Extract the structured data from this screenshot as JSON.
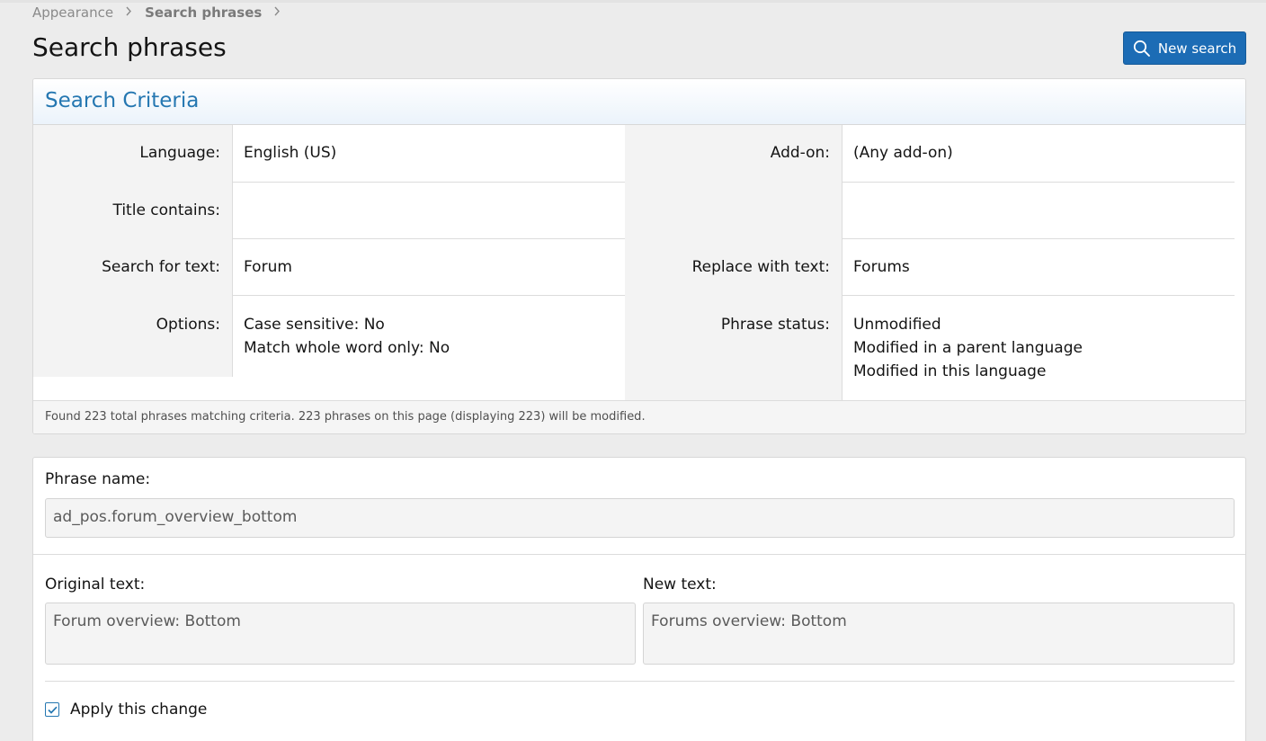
{
  "breadcrumb": [
    "Appearance",
    "Search phrases"
  ],
  "page_title": "Search phrases",
  "header": {
    "new_search_label": "New search"
  },
  "criteria": {
    "title": "Search Criteria",
    "left": {
      "language_label": "Language:",
      "language_value": "English (US)",
      "title_contains_label": "Title contains:",
      "title_contains_value": "",
      "search_text_label": "Search for text:",
      "search_text_value": "Forum",
      "options_label": "Options:",
      "options_values": [
        "Case sensitive: No",
        "Match whole word only: No"
      ]
    },
    "right": {
      "addon_label": "Add-on:",
      "addon_value": "(Any add-on)",
      "replace_label": "Replace with text:",
      "replace_value": "Forums",
      "status_label": "Phrase status:",
      "status_values": [
        "Unmodified",
        "Modified in a parent language",
        "Modified in this language"
      ]
    },
    "footer": "Found 223 total phrases matching criteria. 223 phrases on this page (displaying 223) will be modified."
  },
  "phrase": {
    "name_label": "Phrase name:",
    "name_value": "ad_pos.forum_overview_bottom",
    "original_label": "Original text:",
    "original_value": "Forum overview: Bottom",
    "new_label": "New text:",
    "new_value": "Forums overview: Bottom",
    "apply_label": "Apply this change",
    "apply_checked": true
  },
  "colors": {
    "accent": "#2577b1",
    "button": "#1c6cb5",
    "page_bg": "#ececec"
  }
}
